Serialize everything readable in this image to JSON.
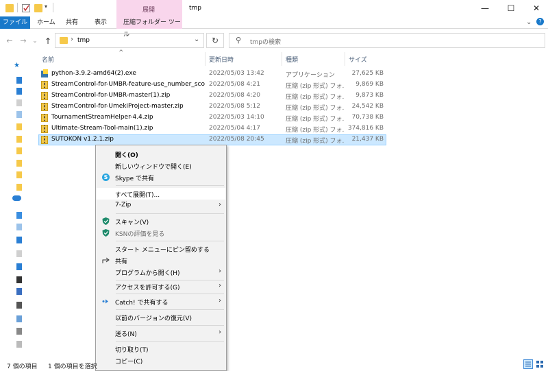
{
  "window": {
    "title": "tmp",
    "context_tab_group": "展開",
    "minimize_glyph": "—",
    "maximize_glyph": "☐",
    "close_glyph": "✕"
  },
  "ribbon": {
    "tabs": [
      {
        "label": "ファイル"
      },
      {
        "label": "ホーム"
      },
      {
        "label": "共有"
      },
      {
        "label": "表示"
      },
      {
        "label": "圧縮フォルダー ツール"
      }
    ],
    "expand_glyph": "⌄",
    "help_glyph": "?"
  },
  "address": {
    "path": "tmp",
    "search_placeholder": "tmpの検索",
    "back_glyph": "←",
    "forward_glyph": "→",
    "recent_glyph": "⌄",
    "up_glyph": "↑",
    "dropdown_glyph": "⌄",
    "refresh_glyph": "↻",
    "search_glyph": "⚲"
  },
  "columns": {
    "name": "名前",
    "date": "更新日時",
    "type": "種類",
    "size": "サイズ",
    "sort_glyph": "^"
  },
  "files": [
    {
      "name": "python-3.9.2-amd64(2).exe",
      "date": "2022/05/03 13:42",
      "type": "アプリケーション",
      "size": "27,625 KB",
      "icon": "exe-icon"
    },
    {
      "name": "StreamControl-for-UMBR-feature-use_number_scor...",
      "date": "2022/05/08 4:21",
      "type": "圧縮 (zip 形式) フォ...",
      "size": "9,869 KB",
      "icon": "zip-icon"
    },
    {
      "name": "StreamControl-for-UMBR-master(1).zip",
      "date": "2022/05/08 4:20",
      "type": "圧縮 (zip 形式) フォ...",
      "size": "9,873 KB",
      "icon": "zip-icon"
    },
    {
      "name": "StreamControl-for-UmekiProject-master.zip",
      "date": "2022/05/08 5:12",
      "type": "圧縮 (zip 形式) フォ...",
      "size": "24,542 KB",
      "icon": "zip-icon"
    },
    {
      "name": "TournamentStreamHelper-4.4.zip",
      "date": "2022/05/03 14:10",
      "type": "圧縮 (zip 形式) フォ...",
      "size": "70,738 KB",
      "icon": "zip-icon"
    },
    {
      "name": "Ultimate-Stream-Tool-main(1).zip",
      "date": "2022/05/04 4:17",
      "type": "圧縮 (zip 形式) フォ...",
      "size": "374,816 KB",
      "icon": "zip-icon"
    },
    {
      "name": "SUTOKON v1.2.1.zip",
      "date": "2022/05/08 20:45",
      "type": "圧縮 (zip 形式) フォ...",
      "size": "21,437 KB",
      "icon": "zip-icon",
      "selected": true
    }
  ],
  "context_menu": {
    "items": [
      {
        "label": "開く(O)"
      },
      {
        "label": "新しいウィンドウで開く(E)"
      },
      {
        "label": "Skype で共有",
        "icon": "skype-icon"
      },
      {
        "label": "すべて展開(T)..."
      },
      {
        "label": "7-Zip",
        "submenu": true
      },
      {
        "label": "スキャン(V)",
        "icon": "shield-icon"
      },
      {
        "label": "KSNの評価を見る",
        "icon": "shield-icon",
        "disabled": true
      },
      {
        "label": "スタート メニューにピン留めする"
      },
      {
        "label": "共有",
        "icon": "share-icon"
      },
      {
        "label": "プログラムから開く(H)",
        "submenu": true
      },
      {
        "label": "アクセスを許可する(G)",
        "submenu": true
      },
      {
        "label": "Catch! で共有する",
        "icon": "catch-icon",
        "submenu": true
      },
      {
        "label": "以前のバージョンの復元(V)"
      },
      {
        "label": "送る(N)",
        "submenu": true
      },
      {
        "label": "切り取り(T)"
      },
      {
        "label": "コピー(C)"
      }
    ],
    "submenu_glyph": "›"
  },
  "status": {
    "item_count": "7 個の項目",
    "selection": "1 個の項目を選択"
  },
  "colors": {
    "file_tab": "#1979ca",
    "context_tab": "#f9d6ec",
    "selection": "#cce8ff",
    "selection_border": "#99d1ff"
  }
}
